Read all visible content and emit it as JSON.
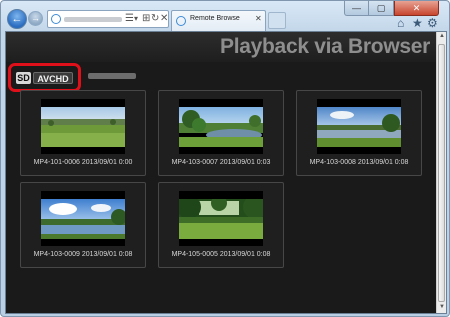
{
  "browser": {
    "tab_title": "Remote Browse",
    "back_glyph": "←",
    "forward_glyph": "→",
    "tab_close_glyph": "✕",
    "window_controls": {
      "minimize": "—",
      "maximize": "▢",
      "close": "✕"
    },
    "toolbar_icons": {
      "home": "⌂",
      "favorites": "★",
      "tools": "⚙"
    },
    "address_icons": {
      "search": "☰",
      "dropdown": "▾",
      "compat": "⊞",
      "refresh": "↻",
      "stop": "✕"
    }
  },
  "page": {
    "title": "Playback via Browser",
    "format_selector": {
      "sd_label": "SD",
      "avchd_label": "AVCHD",
      "selected": "AVCHD"
    },
    "accent_color": "#e0101b",
    "videos": [
      {
        "caption": "MP4-101-0006 2013/09/01 0:00",
        "scene": "meadow"
      },
      {
        "caption": "MP4-103-0007 2013/09/01 0:03",
        "scene": "pond"
      },
      {
        "caption": "MP4-103-0008 2013/09/01 0:08",
        "scene": "lake"
      },
      {
        "caption": "MP4-103-0009 2013/09/01 0:08",
        "scene": "lake-cloudy"
      },
      {
        "caption": "MP4-105-0005 2013/09/01 0:08",
        "scene": "forest-meadow"
      }
    ]
  },
  "scrollbar": {
    "up_glyph": "▲",
    "down_glyph": "▼"
  }
}
